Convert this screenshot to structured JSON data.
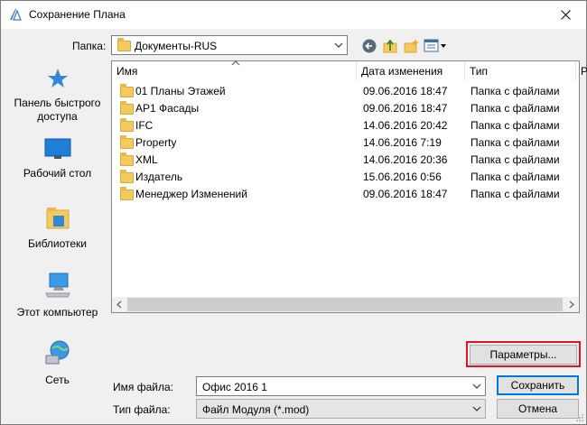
{
  "window": {
    "title": "Сохранение Плана"
  },
  "toolbar": {
    "folder_label": "Папка:",
    "folder_value": "Документы-RUS"
  },
  "sidebar": {
    "items": [
      {
        "label": "Панель быстрого доступа",
        "icon": "star-icon"
      },
      {
        "label": "Рабочий стол",
        "icon": "desktop-icon"
      },
      {
        "label": "Библиотеки",
        "icon": "libraries-icon"
      },
      {
        "label": "Этот компьютер",
        "icon": "computer-icon"
      },
      {
        "label": "Сеть",
        "icon": "network-icon"
      }
    ]
  },
  "file_list": {
    "columns": [
      "Имя",
      "Дата изменения",
      "Тип",
      "Р"
    ],
    "rows": [
      {
        "name": "01 Планы Этажей",
        "date": "09.06.2016 18:47",
        "type": "Папка с файлами"
      },
      {
        "name": "АР1 Фасады",
        "date": "09.06.2016 18:47",
        "type": "Папка с файлами"
      },
      {
        "name": "IFC",
        "date": "14.06.2016 20:42",
        "type": "Папка с файлами"
      },
      {
        "name": "Property",
        "date": "14.06.2016 7:19",
        "type": "Папка с файлами"
      },
      {
        "name": "XML",
        "date": "14.06.2016 20:36",
        "type": "Папка с файлами"
      },
      {
        "name": "Издатель",
        "date": "15.06.2016 0:56",
        "type": "Папка с файлами"
      },
      {
        "name": "Менеджер Изменений",
        "date": "09.06.2016 18:47",
        "type": "Папка с файлами"
      }
    ]
  },
  "options_button": "Параметры...",
  "filename": {
    "label": "Имя файла:",
    "value": "Офис 2016 1"
  },
  "filetype": {
    "label": "Тип файла:",
    "value": "Файл Модуля (*.mod)"
  },
  "buttons": {
    "save": "Сохранить",
    "cancel": "Отмена"
  },
  "colors": {
    "accent": "#0078d7",
    "highlight": "#e81123",
    "folder": "#f4c95d"
  }
}
